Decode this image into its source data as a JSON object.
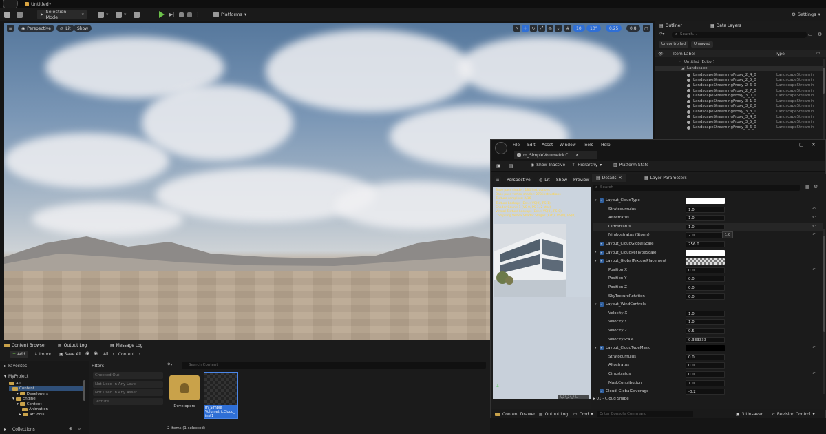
{
  "title_bar": {
    "doc_tab": "Untitled•"
  },
  "toolbar": {
    "selection_mode": "Selection Mode",
    "platforms": "Platforms",
    "settings": "Settings"
  },
  "viewport": {
    "perspective": "Perspective",
    "lit": "Lit",
    "show": "Show",
    "snap_angle": "10",
    "rot_angle": "10°",
    "scale_snap": "0.25",
    "cam_speed": "0.8"
  },
  "outliner": {
    "tab_outliner": "Outliner",
    "tab_data_layers": "Data Layers",
    "search_placeholder": "Search...",
    "filter_unsaved": "Unsaved",
    "filter_uncontrolled": "Uncontrolled",
    "col_label": "Item Label",
    "col_type": "Type",
    "root": "Untitled (Editor)",
    "landscape": "Landscape",
    "items": [
      {
        "name": "LandscapeStreamingProxy_2_4_0",
        "type": "LandscapeStreamin"
      },
      {
        "name": "LandscapeStreamingProxy_2_5_0",
        "type": "LandscapeStreamin"
      },
      {
        "name": "LandscapeStreamingProxy_2_6_0",
        "type": "LandscapeStreamin"
      },
      {
        "name": "LandscapeStreamingProxy_2_7_0",
        "type": "LandscapeStreamin"
      },
      {
        "name": "LandscapeStreamingProxy_3_0_0",
        "type": "LandscapeStreamin"
      },
      {
        "name": "LandscapeStreamingProxy_3_1_0",
        "type": "LandscapeStreamin"
      },
      {
        "name": "LandscapeStreamingProxy_3_2_0",
        "type": "LandscapeStreamin"
      },
      {
        "name": "LandscapeStreamingProxy_3_3_0",
        "type": "LandscapeStreamin"
      },
      {
        "name": "LandscapeStreamingProxy_3_4_0",
        "type": "LandscapeStreamin"
      },
      {
        "name": "LandscapeStreamingProxy_3_5_0",
        "type": "LandscapeStreamin"
      },
      {
        "name": "LandscapeStreamingProxy_3_6_0",
        "type": "LandscapeStreamin"
      }
    ]
  },
  "content_browser": {
    "tab_content_browser": "Content Browser",
    "tab_output_log": "Output Log",
    "tab_message_log": "Message Log",
    "add": "Add",
    "import": "Import",
    "save_all": "Save All",
    "path_all": "All",
    "path_content": "Content",
    "favorites": "Favorites",
    "project": "MyProject",
    "tree": [
      "All",
      "Content",
      "Developers",
      "Engine",
      "Content",
      "Animation",
      "ArtTools"
    ],
    "filters_title": "Filters",
    "filters": [
      "Checked Out",
      "Not Used In Any Level",
      "Not Used In Any Asset",
      "Texture"
    ],
    "search_placeholder": "Search Content",
    "folder_developers": "Developers",
    "asset_name": "m_Simple\nVolumetricCloud_\ninst1",
    "status": "2 items (1 selected)",
    "collections": "Collections"
  },
  "material_editor": {
    "menu": [
      "File",
      "Edit",
      "Asset",
      "Window",
      "Tools",
      "Help"
    ],
    "tab": "m_SimpleVolumetricCl...",
    "show_inactive": "Show Inactive",
    "hierarchy": "Hierarchy",
    "platform_stats": "Platform Stats",
    "preview_perspective": "Perspective",
    "preview_lit": "Lit",
    "preview_show": "Show",
    "preview_preview": "Preview",
    "details_tab": "Details",
    "layer_params_tab": "Layer Parameters",
    "search_placeholder": "Search",
    "stats_lines": [
      "Base pass shader: 184 instructions",
      "Base pass vertex shader: 273 instructions",
      "Texture samplers: 2/16",
      "Texture Lookups (Est.): VS(0), PS(1)",
      "Shader Count: 1 (VS 0, PS 1, 2 stat)",
      "Virtual Texture Lookups (Est.): VS(0), PS(0)",
      "Compiling Vertex Shader Stages (Est.): VS(0), PS(0)"
    ],
    "tooltip": "1.0",
    "cloud_shape_group": "01 - Cloud Shape",
    "bottom_content_drawer": "Content Drawer",
    "bottom_output_log": "Output Log",
    "bottom_cmd": "Cmd",
    "console_placeholder": "Enter Console Command",
    "unsaved": "3 Unsaved",
    "revision_control": "Revision Control"
  },
  "details_rows": [
    {
      "kind": "group",
      "label": "Layout_CloudType",
      "swatch": "#ffffff"
    },
    {
      "kind": "param",
      "label": "Stratocumulus",
      "value": "1.0"
    },
    {
      "kind": "param",
      "label": "Altostratus",
      "value": "1.0"
    },
    {
      "kind": "param",
      "label": "Cirrostratus",
      "value": "1.0"
    },
    {
      "kind": "param",
      "label": "Nimbostratus (Storm)",
      "value": "2.0"
    },
    {
      "kind": "sub",
      "label": "Layout_CloudGlobalScale",
      "value": "256.0"
    },
    {
      "kind": "group",
      "label": "Layout_CloudPerTypeScale",
      "swatch": "#ffffff"
    },
    {
      "kind": "group",
      "label": "Layout_GlobalTexturePlacement",
      "swatch": "checker"
    },
    {
      "kind": "param",
      "label": "Position X",
      "value": "0.0"
    },
    {
      "kind": "param",
      "label": "Position Y",
      "value": "0.0"
    },
    {
      "kind": "param",
      "label": "Position Z",
      "value": "0.0"
    },
    {
      "kind": "param",
      "label": "SkyTextureRotation",
      "value": "0.0"
    },
    {
      "kind": "group",
      "label": "Layout_WindControls",
      "swatch": "checker"
    },
    {
      "kind": "param",
      "label": "Velocity X",
      "value": "1.0"
    },
    {
      "kind": "param",
      "label": "Velocity Y",
      "value": "1.0"
    },
    {
      "kind": "param",
      "label": "Velocity Z",
      "value": "0.5"
    },
    {
      "kind": "param",
      "label": "VelocityScale",
      "value": "0.333333"
    },
    {
      "kind": "group",
      "label": "Layout_CloudTypeMask",
      "swatch": "#000000"
    },
    {
      "kind": "param",
      "label": "Stratocumulus",
      "value": "0.0"
    },
    {
      "kind": "param",
      "label": "Altostratus",
      "value": "0.0"
    },
    {
      "kind": "param",
      "label": "Cirrostratus",
      "value": "0.0"
    },
    {
      "kind": "param",
      "label": "MaskContribution",
      "value": "1.0"
    },
    {
      "kind": "sub",
      "label": "Cloud_GlobalCoverage",
      "value": "-0.2"
    }
  ],
  "colors": {
    "accent": "#2f6fd6",
    "check": "#2f5f9e",
    "yellow_stats": "#ffd54a",
    "folder": "#c9a24a"
  }
}
